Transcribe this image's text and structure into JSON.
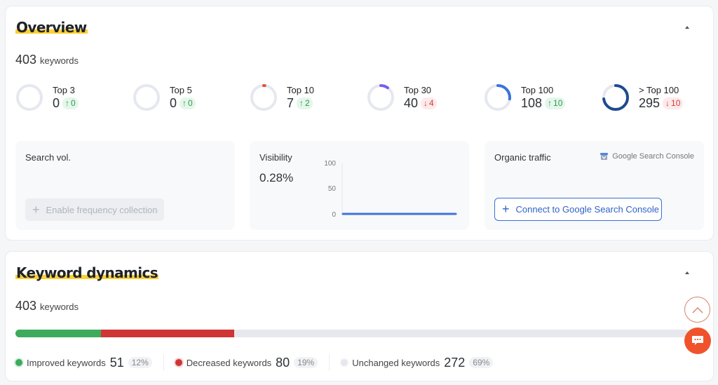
{
  "overview": {
    "title": "Overview",
    "keywords_count": "403",
    "keywords_label": "keywords",
    "tops": [
      {
        "label": "Top 3",
        "value": "0",
        "delta": "0",
        "direction": "up",
        "share": 0,
        "color": "#e6e8ef"
      },
      {
        "label": "Top 5",
        "value": "0",
        "delta": "0",
        "direction": "up",
        "share": 0,
        "color": "#e6e8ef"
      },
      {
        "label": "Top 10",
        "value": "7",
        "delta": "2",
        "direction": "up",
        "share": 0.017,
        "color": "#e8503a"
      },
      {
        "label": "Top 30",
        "value": "40",
        "delta": "4",
        "direction": "down",
        "share": 0.1,
        "color": "#7b5cf0"
      },
      {
        "label": "Top 100",
        "value": "108",
        "delta": "10",
        "direction": "up",
        "share": 0.27,
        "color": "#3a73e0"
      },
      {
        "label": "> Top 100",
        "value": "295",
        "delta": "10",
        "direction": "down",
        "share": 0.73,
        "color": "#1f4a8f"
      }
    ],
    "search_vol": {
      "title": "Search vol.",
      "button_label": "Enable frequency collection"
    },
    "visibility": {
      "title": "Visibility",
      "value": "0.28%",
      "y_ticks": [
        "100",
        "50",
        "0"
      ],
      "line_color": "#3f72dc"
    },
    "organic": {
      "title": "Organic traffic",
      "source_label": "Google Search Console",
      "button_label": "Connect to Google Search Console"
    }
  },
  "dynamics": {
    "title": "Keyword dynamics",
    "keywords_count": "403",
    "keywords_label": "keywords",
    "segments": [
      {
        "name": "improved",
        "label": "Improved keywords",
        "value": "51",
        "pct": "12%",
        "fraction": 0.1266,
        "color": "#3daa5c"
      },
      {
        "name": "decreased",
        "label": "Decreased keywords",
        "value": "80",
        "pct": "19%",
        "fraction": 0.1985,
        "color": "#d13434"
      },
      {
        "name": "unchanged",
        "label": "Unchanged keywords",
        "value": "272",
        "pct": "69%",
        "fraction": 0.6749,
        "color": "#e6e8ed"
      }
    ]
  },
  "icons": {
    "collapse": "chevron-up-icon",
    "scroll_top": "arrow-up-icon",
    "chat": "chat-icon",
    "plus": "plus-icon",
    "gsc": "google-search-console-icon"
  }
}
